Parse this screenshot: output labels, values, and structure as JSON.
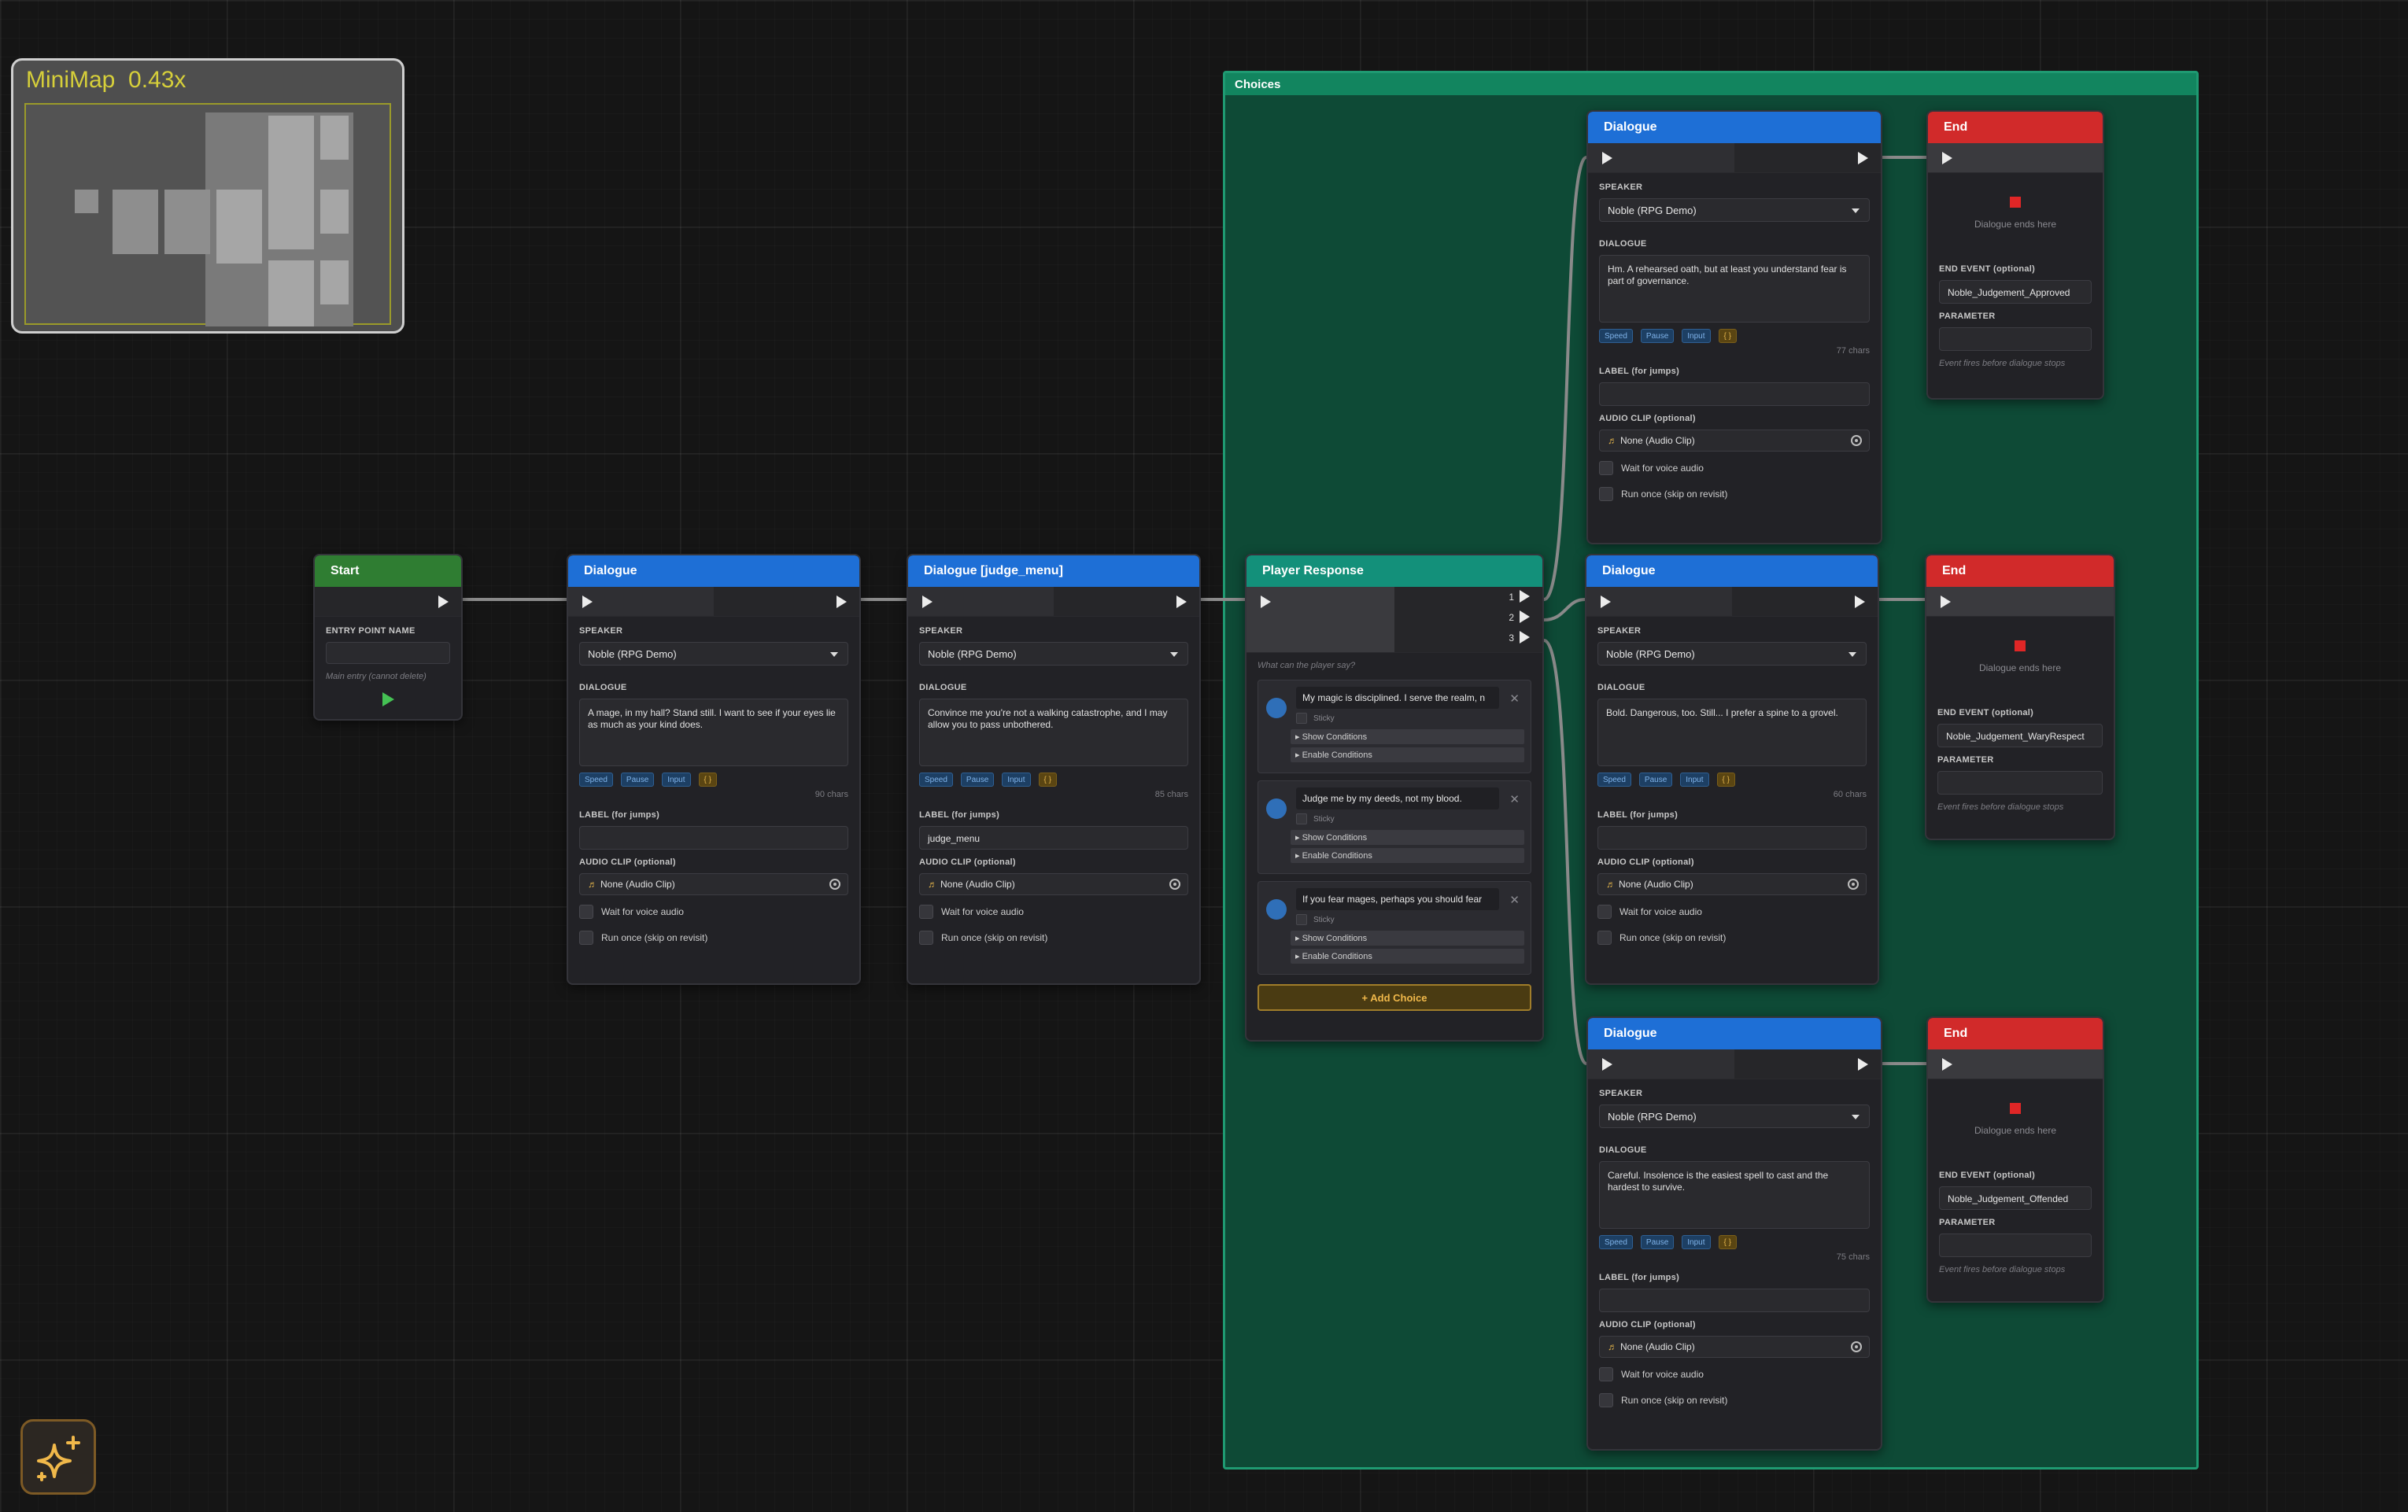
{
  "minimap": {
    "title": "MiniMap",
    "zoom": "0.43x"
  },
  "group": {
    "title": "Choices"
  },
  "ai_button": {
    "icon": "sparkles-icon"
  },
  "start": {
    "title": "Start",
    "entry_label": "ENTRY POINT NAME",
    "entry_value": "",
    "hint": "Main entry (cannot delete)"
  },
  "common": {
    "speaker_label": "SPEAKER",
    "dialogue_label": "DIALOGUE",
    "tags": [
      "Speed",
      "Pause",
      "Input",
      "{ }"
    ],
    "label_label": "LABEL (for jumps)",
    "audio_label": "AUDIO CLIP (optional)",
    "audio_value": "None (Audio Clip)",
    "wait_label": "Wait for voice audio",
    "run_once_label": "Run once (skip on revisit)",
    "end_title": "End",
    "end_text": "Dialogue ends here",
    "end_event_label": "END EVENT (optional)",
    "parameter_label": "PARAMETER",
    "end_hint": "Event fires before dialogue stops"
  },
  "dialogue_1": {
    "title": "Dialogue",
    "speaker": "Noble (RPG Demo)",
    "text": "A mage, in my hall? Stand still. I want to see if your eyes lie as much as your kind does.",
    "chars": "90 chars",
    "label": ""
  },
  "dialogue_2": {
    "title": "Dialogue [judge_menu]",
    "speaker": "Noble (RPG Demo)",
    "text": "Convince me you're not a walking catastrophe, and I may allow you to pass unbothered.",
    "chars": "85 chars",
    "label": "judge_menu"
  },
  "player_response": {
    "title": "Player Response",
    "outputs": [
      "1",
      "2",
      "3"
    ],
    "prompt": "What can the player say?",
    "sticky_label": "Sticky",
    "show_cond": "▸ Show Conditions",
    "enable_cond": "▸ Enable Conditions",
    "choices": [
      {
        "text": "My magic is disciplined. I serve the realm, n"
      },
      {
        "text": "Judge me by my deeds, not my blood."
      },
      {
        "text": "If you fear mages, perhaps you should fear"
      }
    ],
    "add_choice": "+ Add Choice"
  },
  "dialogue_a": {
    "title": "Dialogue",
    "speaker": "Noble (RPG Demo)",
    "text": "Hm. A rehearsed oath, but at least you understand fear is part of governance.",
    "chars": "77 chars",
    "label": ""
  },
  "dialogue_b": {
    "title": "Dialogue",
    "speaker": "Noble (RPG Demo)",
    "text": "Bold. Dangerous, too. Still... I prefer a spine to a grovel.",
    "chars": "60 chars",
    "label": ""
  },
  "dialogue_c": {
    "title": "Dialogue",
    "speaker": "Noble (RPG Demo)",
    "text": "Careful. Insolence is the easiest spell to cast and the hardest to survive.",
    "chars": "75 chars",
    "label": ""
  },
  "end_a": {
    "event": "Noble_Judgement_Approved",
    "parameter": ""
  },
  "end_b": {
    "event": "Noble_Judgement_WaryRespect",
    "parameter": ""
  },
  "end_c": {
    "event": "Noble_Judgement_Offended",
    "parameter": ""
  },
  "colors": {
    "start_header": "#2f7d32",
    "dialogue_header": "#1e6fd6",
    "response_header": "#13907a",
    "end_header": "#d12a2a",
    "group_fill": "#0e4a36",
    "accent": "#f0b84a"
  }
}
